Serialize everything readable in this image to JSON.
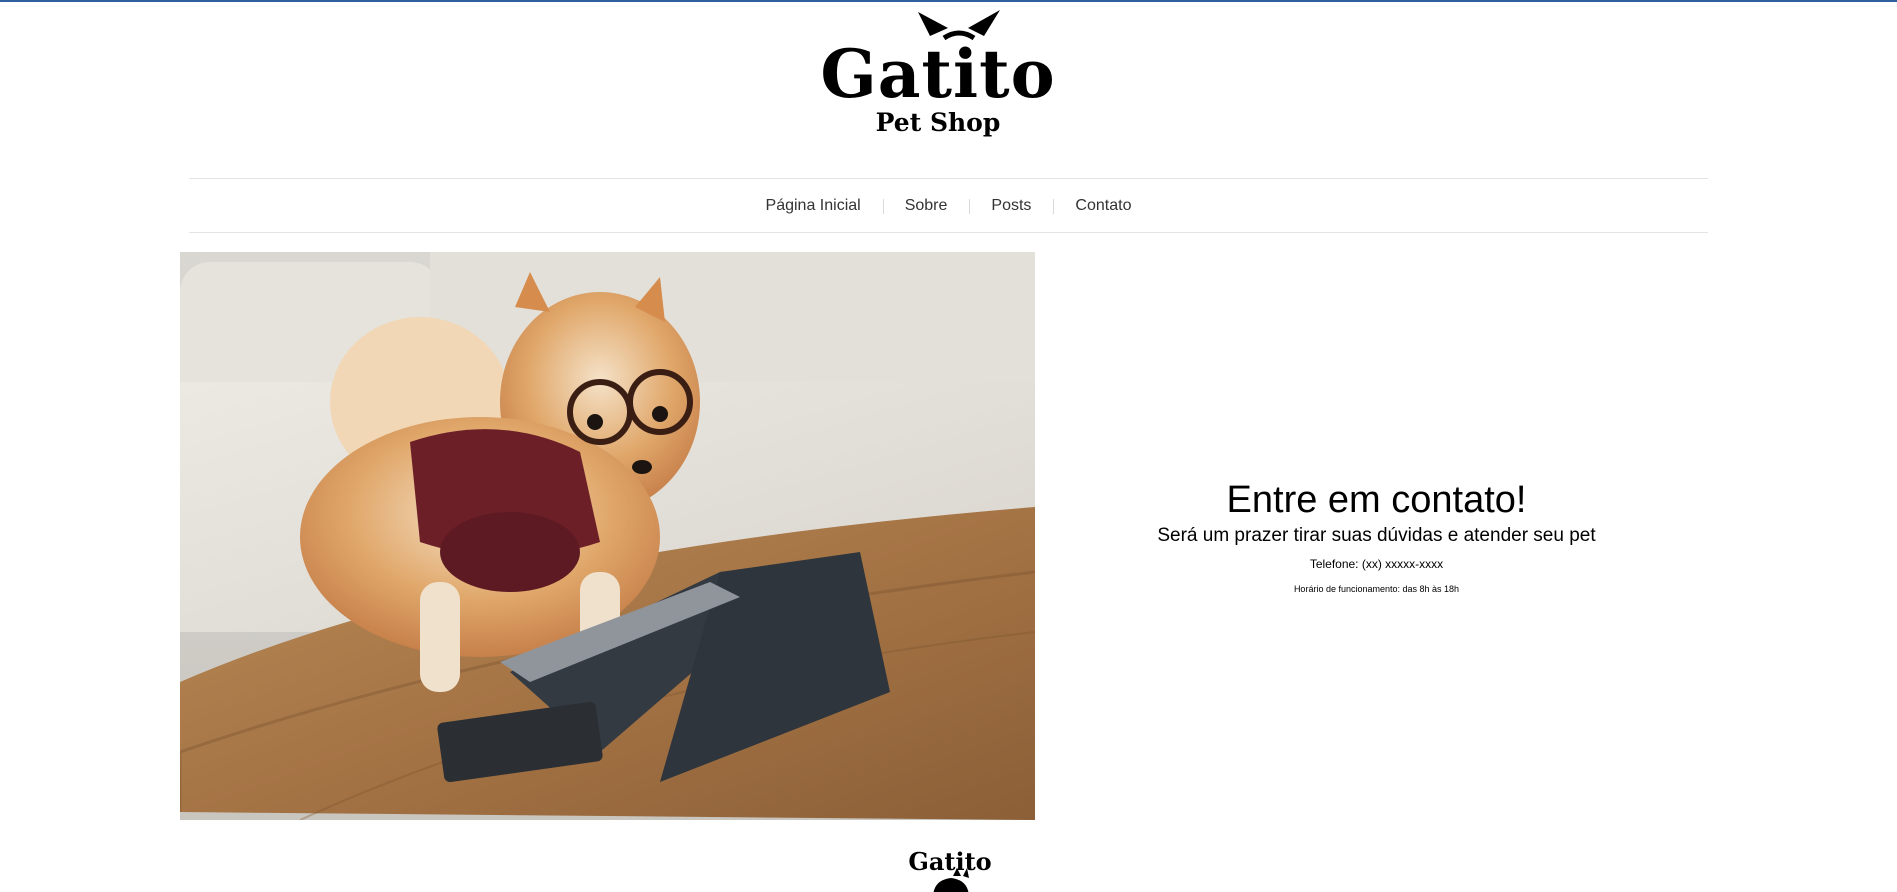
{
  "logo": {
    "wordmark": "Gatito",
    "tagline": "Pet Shop"
  },
  "nav": {
    "items": [
      {
        "label": "Página Inicial"
      },
      {
        "label": "Sobre"
      },
      {
        "label": "Posts"
      },
      {
        "label": "Contato"
      }
    ]
  },
  "contact": {
    "title": "Entre em contato!",
    "subtitle": "Será um prazer tirar suas dúvidas e atender seu pet",
    "phone": "Telefone: (xx) xxxxx-xxxx",
    "hours": "Horário de funcionamento: das 8h às 18h"
  },
  "footer": {
    "wordmark": "Gatito"
  },
  "colors": {
    "top_border": "#2f5f9e",
    "nav_divider": "#e4e4e4",
    "text": "#000000"
  }
}
